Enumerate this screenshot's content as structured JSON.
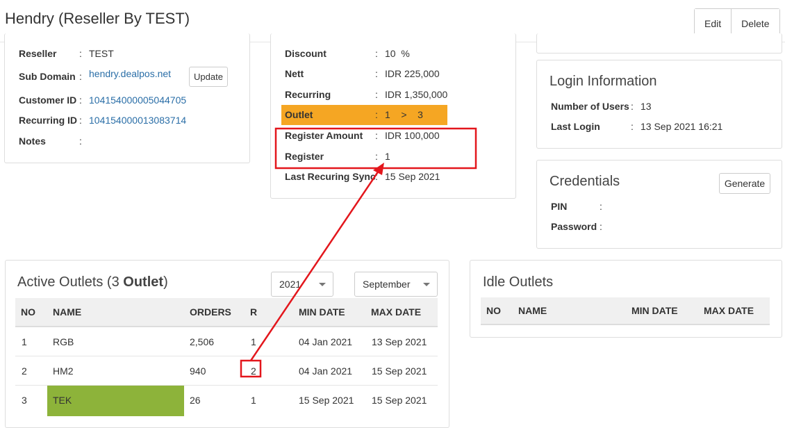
{
  "header": {
    "title": "Hendry (Reseller By TEST)",
    "edit_label": "Edit",
    "delete_label": "Delete"
  },
  "reseller_panel": {
    "reseller_label": "Reseller",
    "reseller_value": "TEST",
    "subdomain_label": "Sub Domain",
    "subdomain_value": "hendry.dealpos.net",
    "update_label": "Update",
    "customer_id_label": "Customer ID",
    "customer_id_value": "104154000005044705",
    "recurring_id_label": "Recurring ID",
    "recurring_id_value": "104154000013083714",
    "notes_label": "Notes",
    "colon": ":"
  },
  "billing_panel": {
    "discount_label": "Discount",
    "discount_value": "10  %",
    "nett_label": "Nett",
    "nett_value": "IDR 225,000",
    "recurring_label": "Recurring",
    "recurring_value": "IDR 1,350,000",
    "outlet_label": "Outlet",
    "outlet_value": "1    >    3",
    "register_amount_label": "Register Amount",
    "register_amount_value": "IDR 100,000",
    "register_label": "Register",
    "register_value": "1",
    "last_sync_label": "Last Recuring Sync",
    "last_sync_value": "15 Sep 2021",
    "highlight_color": "#f5a623",
    "annotation_color": "#e3161c"
  },
  "login_panel": {
    "title": "Login Information",
    "users_label": "Number of Users",
    "users_value": "13",
    "last_login_label": "Last Login",
    "last_login_value": "13 Sep 2021 16:21"
  },
  "credentials_panel": {
    "title": "Credentials",
    "generate_label": "Generate",
    "pin_label": "PIN",
    "password_label": "Password"
  },
  "active_outlets": {
    "title_prefix": "Active Outlets (3 ",
    "title_bold": "Outlet",
    "title_suffix": ")",
    "year": "2021",
    "month": "September",
    "columns": [
      "NO",
      "NAME",
      "ORDERS",
      "R",
      "MIN DATE",
      "MAX DATE"
    ],
    "rows": [
      {
        "no": "1",
        "name": "RGB",
        "orders": "2,506",
        "r": "1",
        "min": "04 Jan 2021",
        "max": "13 Sep 2021"
      },
      {
        "no": "2",
        "name": "HM2",
        "orders": "940",
        "r": "2",
        "min": "04 Jan 2021",
        "max": "15 Sep 2021"
      },
      {
        "no": "3",
        "name": "TEK",
        "orders": "26",
        "r": "1",
        "min": "15 Sep 2021",
        "max": "15 Sep 2021"
      }
    ],
    "highlight_name_color": "#8db33a"
  },
  "idle_outlets": {
    "title": "Idle Outlets",
    "columns": [
      "NO",
      "NAME",
      "MIN DATE",
      "MAX DATE"
    ]
  }
}
